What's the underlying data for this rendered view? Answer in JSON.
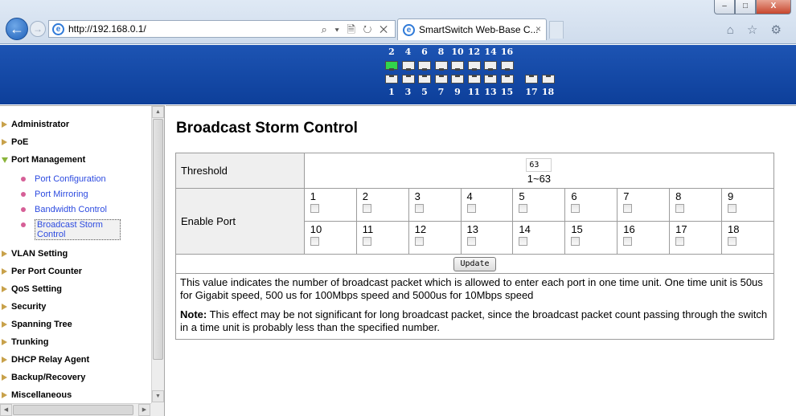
{
  "browser": {
    "url": "http://192.168.0.1/",
    "tab_title": "SmartSwitch Web-Base C...",
    "address_tools": "⌕ ▾ 🗎 ↻ ✕",
    "right_icons": "⌂ ☆ ⚙",
    "window_controls": [
      "–",
      "□",
      "X"
    ]
  },
  "panel": {
    "top_port_numbers": [
      "2",
      "4",
      "6",
      "8",
      "10",
      "12",
      "14",
      "16"
    ],
    "bottom_port_numbers": [
      "1",
      "3",
      "5",
      "7",
      "9",
      "11",
      "13",
      "15",
      "17",
      "18"
    ],
    "port_up": "2",
    "colors": {
      "banner": "#1a4fab",
      "port_up": "#31d64b"
    }
  },
  "sidebar": {
    "items": [
      {
        "label": "Administrator"
      },
      {
        "label": "PoE"
      },
      {
        "label": "Port Management",
        "open": true,
        "children": [
          {
            "label": "Port Configuration"
          },
          {
            "label": "Port Mirroring"
          },
          {
            "label": "Bandwidth Control"
          },
          {
            "label": "Broadcast Storm Control",
            "selected": true
          }
        ]
      },
      {
        "label": "VLAN Setting"
      },
      {
        "label": "Per Port Counter"
      },
      {
        "label": "QoS Setting"
      },
      {
        "label": "Security"
      },
      {
        "label": "Spanning Tree"
      },
      {
        "label": "Trunking"
      },
      {
        "label": "DHCP Relay Agent"
      },
      {
        "label": "Backup/Recovery"
      },
      {
        "label": "Miscellaneous"
      }
    ]
  },
  "main": {
    "title": "Broadcast Storm Control",
    "threshold": {
      "label": "Threshold",
      "value": "63",
      "range": "1~63"
    },
    "enable_port": {
      "label": "Enable Port",
      "row1": [
        "1",
        "2",
        "3",
        "4",
        "5",
        "6",
        "7",
        "8",
        "9"
      ],
      "row2": [
        "10",
        "11",
        "12",
        "13",
        "14",
        "15",
        "16",
        "17",
        "18"
      ]
    },
    "update_label": "Update",
    "description": "This value indicates the number of broadcast packet which is allowed to enter each port in one time unit. One time unit is 50us for Gigabit speed, 500 us for 100Mbps speed and 5000us for 10Mbps speed",
    "note_label": "Note:",
    "note_text": " This effect may be not significant for long broadcast packet, since the broadcast packet count passing through the switch in a time unit is probably less than the specified number."
  }
}
